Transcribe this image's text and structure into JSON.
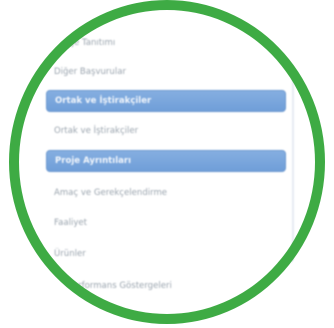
{
  "menu": {
    "items": [
      {
        "type": "item",
        "label": "Proje Tanıtımı"
      },
      {
        "type": "item",
        "label": "Diğer Başvurular"
      },
      {
        "type": "header",
        "label": "Ortak ve İştirakçiler"
      },
      {
        "type": "item",
        "label": "Ortak ve İştirakçiler"
      },
      {
        "type": "header",
        "label": "Proje Ayrıntıları"
      },
      {
        "type": "item",
        "label": "Amaç ve Gerekçelendirme"
      },
      {
        "type": "item",
        "label": "Faaliyet"
      },
      {
        "type": "item",
        "label": "Ürünler"
      },
      {
        "type": "item",
        "label": "Performans Göstergeleri"
      },
      {
        "type": "item",
        "label": ""
      }
    ]
  },
  "colors": {
    "ring": "#3eab44",
    "header_bg": "#6f9ed8",
    "item_text": "#9aa4ae"
  }
}
